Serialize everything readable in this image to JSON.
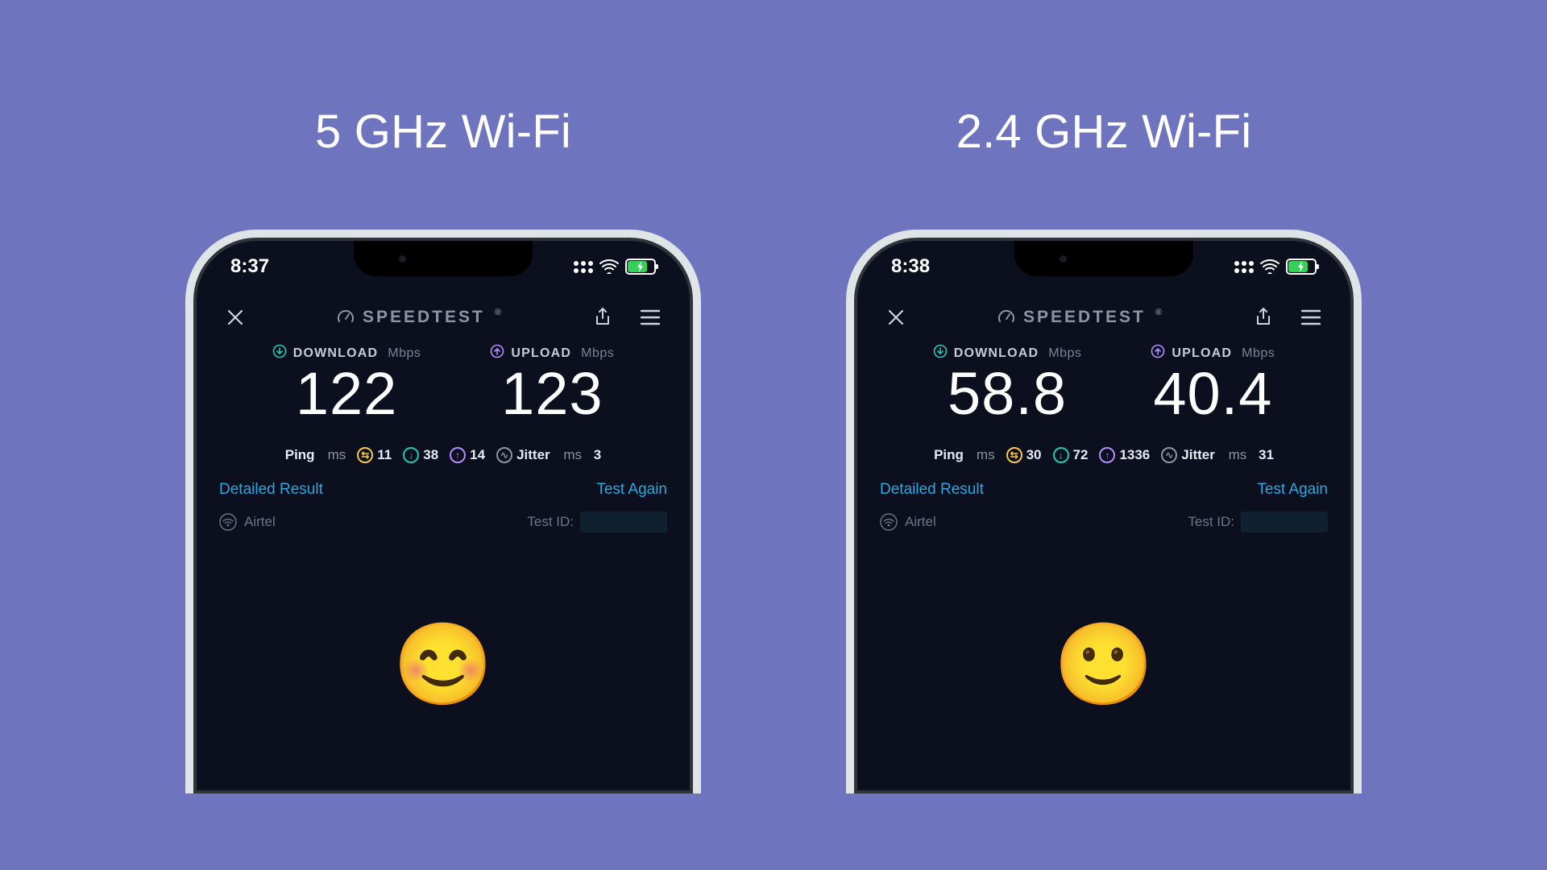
{
  "colors": {
    "bg": "#6e74be",
    "accent_dl": "#24c9b5",
    "accent_ul": "#b48dff",
    "link": "#2aa8df"
  },
  "phones": [
    {
      "title": "5 GHz Wi-Fi",
      "statusbar": {
        "time": "8:37"
      },
      "app": {
        "brand": "SPEEDTEST",
        "brand_tm": "®"
      },
      "download": {
        "label": "DOWNLOAD",
        "unit": "Mbps",
        "value": "122"
      },
      "upload": {
        "label": "UPLOAD",
        "unit": "Mbps",
        "value": "123"
      },
      "ping": {
        "label": "Ping",
        "unit": "ms",
        "idle": "11",
        "down": "38",
        "up": "14",
        "jitter_label": "Jitter",
        "jitter_unit": "ms",
        "jitter": "3"
      },
      "links": {
        "detailed": "Detailed Result",
        "again": "Test Again"
      },
      "isp": {
        "name": "Airtel",
        "testid_label": "Test ID:"
      },
      "emoji": "😊"
    },
    {
      "title": "2.4 GHz Wi-Fi",
      "statusbar": {
        "time": "8:38"
      },
      "app": {
        "brand": "SPEEDTEST",
        "brand_tm": "®"
      },
      "download": {
        "label": "DOWNLOAD",
        "unit": "Mbps",
        "value": "58.8"
      },
      "upload": {
        "label": "UPLOAD",
        "unit": "Mbps",
        "value": "40.4"
      },
      "ping": {
        "label": "Ping",
        "unit": "ms",
        "idle": "30",
        "down": "72",
        "up": "1336",
        "jitter_label": "Jitter",
        "jitter_unit": "ms",
        "jitter": "31"
      },
      "links": {
        "detailed": "Detailed Result",
        "again": "Test Again"
      },
      "isp": {
        "name": "Airtel",
        "testid_label": "Test ID:"
      },
      "emoji": "🙂"
    }
  ]
}
